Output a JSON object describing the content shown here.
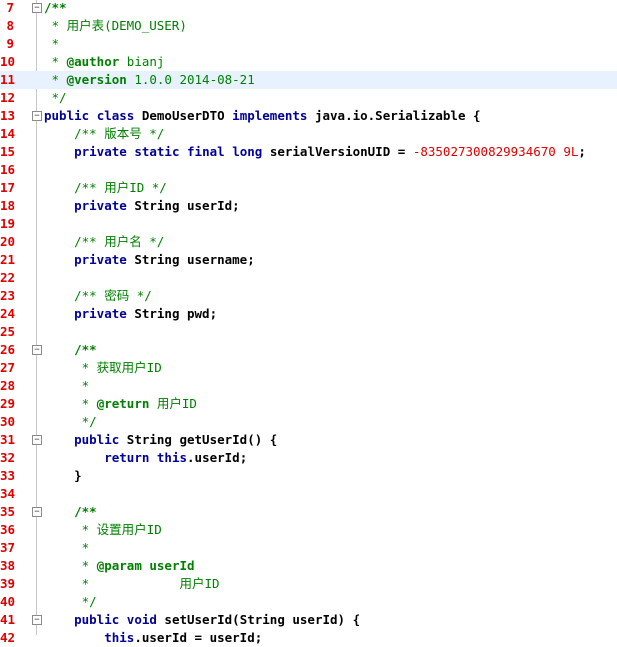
{
  "editor": {
    "colors": {
      "line_number": "#e00000",
      "keyword": "#00009a",
      "comment": "#008000",
      "number": "#e00000",
      "current_line": "#e8f2fe"
    },
    "current_line": 11,
    "lines": [
      {
        "num": "7",
        "fold": "minus",
        "tokens": [
          {
            "t": "/**",
            "c": "cmkw"
          }
        ]
      },
      {
        "num": "8",
        "tokens": [
          {
            "t": " * 用户表(DEMO_USER)",
            "c": "cm"
          }
        ]
      },
      {
        "num": "9",
        "tokens": [
          {
            "t": " *",
            "c": "cm"
          }
        ]
      },
      {
        "num": "10",
        "tokens": [
          {
            "t": " * ",
            "c": "cm"
          },
          {
            "t": "@author",
            "c": "cmkw"
          },
          {
            "t": " bianj",
            "c": "cm"
          }
        ]
      },
      {
        "num": "11",
        "tokens": [
          {
            "t": " * ",
            "c": "cm"
          },
          {
            "t": "@version",
            "c": "cmkw"
          },
          {
            "t": " 1.0.0 2014-08-21",
            "c": "cm"
          }
        ]
      },
      {
        "num": "12",
        "tokens": [
          {
            "t": " */",
            "c": "cm"
          }
        ]
      },
      {
        "num": "13",
        "fold": "minus",
        "tokens": [
          {
            "t": "public",
            "c": "kw"
          },
          {
            "t": " ",
            "c": "pl"
          },
          {
            "t": "class",
            "c": "kw"
          },
          {
            "t": " DemoUserDTO ",
            "c": "id"
          },
          {
            "t": "implements",
            "c": "kw"
          },
          {
            "t": " java.io.Serializable {",
            "c": "id"
          }
        ]
      },
      {
        "num": "14",
        "tokens": [
          {
            "t": "    /** 版本号 */",
            "c": "cm"
          }
        ]
      },
      {
        "num": "15",
        "tokens": [
          {
            "t": "    ",
            "c": "pl"
          },
          {
            "t": "private",
            "c": "kw"
          },
          {
            "t": " ",
            "c": "pl"
          },
          {
            "t": "static",
            "c": "kw"
          },
          {
            "t": " ",
            "c": "pl"
          },
          {
            "t": "final",
            "c": "kw"
          },
          {
            "t": " ",
            "c": "pl"
          },
          {
            "t": "long",
            "c": "kw"
          },
          {
            "t": " serialVersionUID = ",
            "c": "id"
          },
          {
            "t": "-835027300829934670 9L",
            "c": "num"
          },
          {
            "t": ";",
            "c": "id"
          }
        ]
      },
      {
        "num": "16",
        "tokens": []
      },
      {
        "num": "17",
        "tokens": [
          {
            "t": "    /** 用户ID */",
            "c": "cm"
          }
        ]
      },
      {
        "num": "18",
        "tokens": [
          {
            "t": "    ",
            "c": "pl"
          },
          {
            "t": "private",
            "c": "kw"
          },
          {
            "t": " String userId;",
            "c": "id"
          }
        ]
      },
      {
        "num": "19",
        "tokens": []
      },
      {
        "num": "20",
        "tokens": [
          {
            "t": "    /** 用户名 */",
            "c": "cm"
          }
        ]
      },
      {
        "num": "21",
        "tokens": [
          {
            "t": "    ",
            "c": "pl"
          },
          {
            "t": "private",
            "c": "kw"
          },
          {
            "t": " String username;",
            "c": "id"
          }
        ]
      },
      {
        "num": "22",
        "tokens": []
      },
      {
        "num": "23",
        "tokens": [
          {
            "t": "    /** 密码 */",
            "c": "cm"
          }
        ]
      },
      {
        "num": "24",
        "tokens": [
          {
            "t": "    ",
            "c": "pl"
          },
          {
            "t": "private",
            "c": "kw"
          },
          {
            "t": " String pwd;",
            "c": "id"
          }
        ]
      },
      {
        "num": "25",
        "tokens": []
      },
      {
        "num": "26",
        "fold": "minus",
        "tokens": [
          {
            "t": "    /**",
            "c": "cmkw"
          }
        ]
      },
      {
        "num": "27",
        "tokens": [
          {
            "t": "     * 获取用户ID",
            "c": "cm"
          }
        ]
      },
      {
        "num": "28",
        "tokens": [
          {
            "t": "     *",
            "c": "cm"
          }
        ]
      },
      {
        "num": "29",
        "tokens": [
          {
            "t": "     * ",
            "c": "cm"
          },
          {
            "t": "@return",
            "c": "cmkw"
          },
          {
            "t": " 用户ID",
            "c": "cm"
          }
        ]
      },
      {
        "num": "30",
        "tokens": [
          {
            "t": "     */",
            "c": "cm"
          }
        ]
      },
      {
        "num": "31",
        "fold": "minus",
        "tokens": [
          {
            "t": "    ",
            "c": "pl"
          },
          {
            "t": "public",
            "c": "kw"
          },
          {
            "t": " String getUserId() {",
            "c": "id"
          }
        ]
      },
      {
        "num": "32",
        "tokens": [
          {
            "t": "        ",
            "c": "pl"
          },
          {
            "t": "return",
            "c": "kw"
          },
          {
            "t": " ",
            "c": "pl"
          },
          {
            "t": "this",
            "c": "kw"
          },
          {
            "t": ".userId;",
            "c": "id"
          }
        ]
      },
      {
        "num": "33",
        "tokens": [
          {
            "t": "    }",
            "c": "id"
          }
        ]
      },
      {
        "num": "34",
        "tokens": []
      },
      {
        "num": "35",
        "fold": "minus",
        "tokens": [
          {
            "t": "    /**",
            "c": "cmkw"
          }
        ]
      },
      {
        "num": "36",
        "tokens": [
          {
            "t": "     * 设置用户ID",
            "c": "cm"
          }
        ]
      },
      {
        "num": "37",
        "tokens": [
          {
            "t": "     *",
            "c": "cm"
          }
        ]
      },
      {
        "num": "38",
        "tokens": [
          {
            "t": "     * ",
            "c": "cm"
          },
          {
            "t": "@param",
            "c": "cmkw"
          },
          {
            "t": " userId",
            "c": "cmkw"
          }
        ]
      },
      {
        "num": "39",
        "tokens": [
          {
            "t": "     *            用户ID",
            "c": "cm"
          }
        ]
      },
      {
        "num": "40",
        "tokens": [
          {
            "t": "     */",
            "c": "cm"
          }
        ]
      },
      {
        "num": "41",
        "fold": "minus",
        "tokens": [
          {
            "t": "    ",
            "c": "pl"
          },
          {
            "t": "public",
            "c": "kw"
          },
          {
            "t": " ",
            "c": "pl"
          },
          {
            "t": "void",
            "c": "kw"
          },
          {
            "t": " setUserId(String userId) {",
            "c": "id"
          }
        ]
      },
      {
        "num": "42",
        "tokens": [
          {
            "t": "        ",
            "c": "pl"
          },
          {
            "t": "this",
            "c": "kw"
          },
          {
            "t": ".userId = userId;",
            "c": "id"
          }
        ]
      }
    ]
  }
}
